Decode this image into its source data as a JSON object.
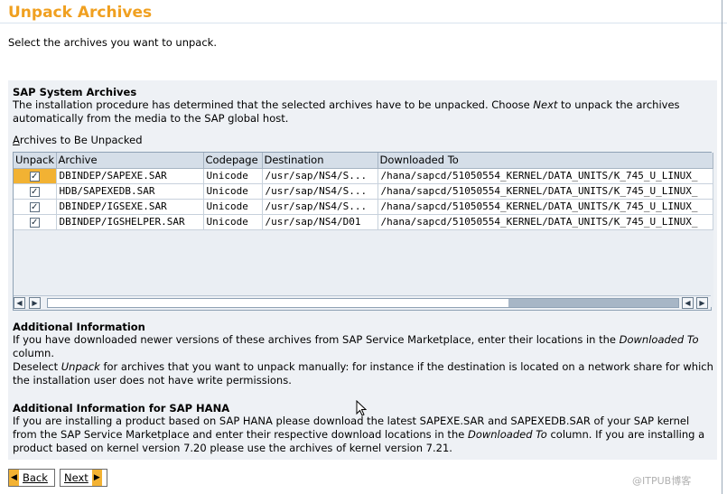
{
  "page": {
    "title": "Unpack Archives",
    "subtitle": "Select the archives you want to unpack."
  },
  "system_archives": {
    "heading": "SAP System Archives",
    "text_line1_a": "The installation procedure has determined that the selected archives have to be unpacked. Choose ",
    "text_line1_italic": "Next",
    "text_line1_b": " to unpack the archives",
    "text_line2": "automatically from the media to the SAP global host."
  },
  "table": {
    "label": "Archives to Be Unpacked",
    "label_mnemonic": "A",
    "label_rest": "rchives to Be Unpacked",
    "columns": [
      "Unpack",
      "Archive",
      "Codepage",
      "Destination",
      "Downloaded To"
    ],
    "rows": [
      {
        "unpack": true,
        "archive": "DBINDEP/SAPEXE.SAR",
        "codepage": "Unicode",
        "destination": "/usr/sap/NS4/S...",
        "downloaded_to": "/hana/sapcd/51050554_KERNEL/DATA_UNITS/K_745_U_LINUX_"
      },
      {
        "unpack": true,
        "archive": "HDB/SAPEXEDB.SAR",
        "codepage": "Unicode",
        "destination": "/usr/sap/NS4/S...",
        "downloaded_to": "/hana/sapcd/51050554_KERNEL/DATA_UNITS/K_745_U_LINUX_"
      },
      {
        "unpack": true,
        "archive": "DBINDEP/IGSEXE.SAR",
        "codepage": "Unicode",
        "destination": "/usr/sap/NS4/S...",
        "downloaded_to": "/hana/sapcd/51050554_KERNEL/DATA_UNITS/K_745_U_LINUX_"
      },
      {
        "unpack": true,
        "archive": "DBINDEP/IGSHELPER.SAR",
        "codepage": "Unicode",
        "destination": "/usr/sap/NS4/D01",
        "downloaded_to": "/hana/sapcd/51050554_KERNEL/DATA_UNITS/K_745_U_LINUX_"
      }
    ],
    "selected_row": 0
  },
  "additional_info": {
    "heading": "Additional Information",
    "line1_a": "If you have downloaded newer versions of these archives from SAP Service Marketplace, enter their locations in the ",
    "line1_italic": "Downloaded To",
    "line2": "column.",
    "line3_a": "Deselect ",
    "line3_italic": "Unpack",
    "line3_b": " for archives that you want to unpack manually: for instance if the destination is located on a network share for which",
    "line4": "the installation user does not have write permissions."
  },
  "hana_info": {
    "heading": "Additional Information for SAP HANA",
    "line1": "If you are installing a product based on SAP HANA please download the latest SAPEXE.SAR and SAPEXEDB.SAR of your SAP kernel",
    "line2_a": "from the SAP Service Marketplace and enter their respective download locations in the ",
    "line2_italic": "Downloaded To",
    "line2_b": " column. If you are installing a",
    "line3": "product based on kernel version 7.20 please use the archives of kernel version 7.21."
  },
  "buttons": {
    "back": "Back",
    "next": "Next"
  },
  "icons": {
    "back": "triangle-left-icon",
    "next": "triangle-right-icon",
    "scroll_left": "scroll-left-icon",
    "scroll_right": "scroll-right-icon",
    "cursor": "mouse-pointer-icon"
  },
  "colors": {
    "title": "#f0a020",
    "accent": "#f3b233",
    "panel": "#eef1f5"
  },
  "watermark": "@ITPUB博客"
}
